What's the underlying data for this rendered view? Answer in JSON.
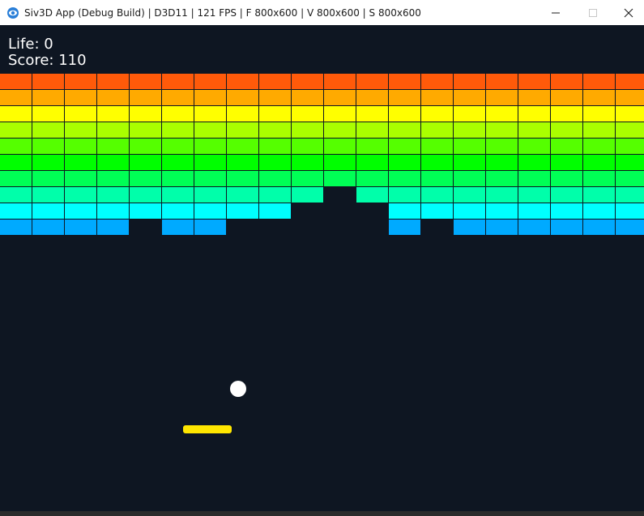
{
  "window": {
    "title": "Siv3D App (Debug Build) | D3D11 | 121 FPS | F 800x600 | V 800x600 | S 800x600",
    "icon": "siv3d-app-icon",
    "controls": [
      "minimize-icon",
      "maximize-icon",
      "close-icon"
    ]
  },
  "hud": {
    "life_text": "Life: 0",
    "score_text": "Score: 110"
  },
  "colors": {
    "background": "#0e1622",
    "ball": "#ffffff",
    "paddle": "#ffe600",
    "rows": [
      "#ff5a0a",
      "#ffaa00",
      "#ffff00",
      "#aaff00",
      "#55ff00",
      "#00ff00",
      "#00ff55",
      "#00ffaa",
      "#00ffff",
      "#00aaff"
    ]
  },
  "bricks": {
    "columns": 20,
    "rows": [
      [
        1,
        1,
        1,
        1,
        1,
        1,
        1,
        1,
        1,
        1,
        1,
        1,
        1,
        1,
        1,
        1,
        1,
        1,
        1,
        1
      ],
      [
        1,
        1,
        1,
        1,
        1,
        1,
        1,
        1,
        1,
        1,
        1,
        1,
        1,
        1,
        1,
        1,
        1,
        1,
        1,
        1
      ],
      [
        1,
        1,
        1,
        1,
        1,
        1,
        1,
        1,
        1,
        1,
        1,
        1,
        1,
        1,
        1,
        1,
        1,
        1,
        1,
        1
      ],
      [
        1,
        1,
        1,
        1,
        1,
        1,
        1,
        1,
        1,
        1,
        1,
        1,
        1,
        1,
        1,
        1,
        1,
        1,
        1,
        1
      ],
      [
        1,
        1,
        1,
        1,
        1,
        1,
        1,
        1,
        1,
        1,
        1,
        1,
        1,
        1,
        1,
        1,
        1,
        1,
        1,
        1
      ],
      [
        1,
        1,
        1,
        1,
        1,
        1,
        1,
        1,
        1,
        1,
        1,
        1,
        1,
        1,
        1,
        1,
        1,
        1,
        1,
        1
      ],
      [
        1,
        1,
        1,
        1,
        1,
        1,
        1,
        1,
        1,
        1,
        1,
        1,
        1,
        1,
        1,
        1,
        1,
        1,
        1,
        1
      ],
      [
        1,
        1,
        1,
        1,
        1,
        1,
        1,
        1,
        1,
        1,
        0,
        1,
        1,
        1,
        1,
        1,
        1,
        1,
        1,
        1
      ],
      [
        1,
        1,
        1,
        1,
        1,
        1,
        1,
        1,
        1,
        0,
        0,
        0,
        1,
        1,
        1,
        1,
        1,
        1,
        1,
        1
      ],
      [
        1,
        1,
        1,
        1,
        0,
        1,
        1,
        0,
        0,
        0,
        0,
        0,
        1,
        0,
        1,
        1,
        1,
        1,
        1,
        1
      ]
    ]
  }
}
